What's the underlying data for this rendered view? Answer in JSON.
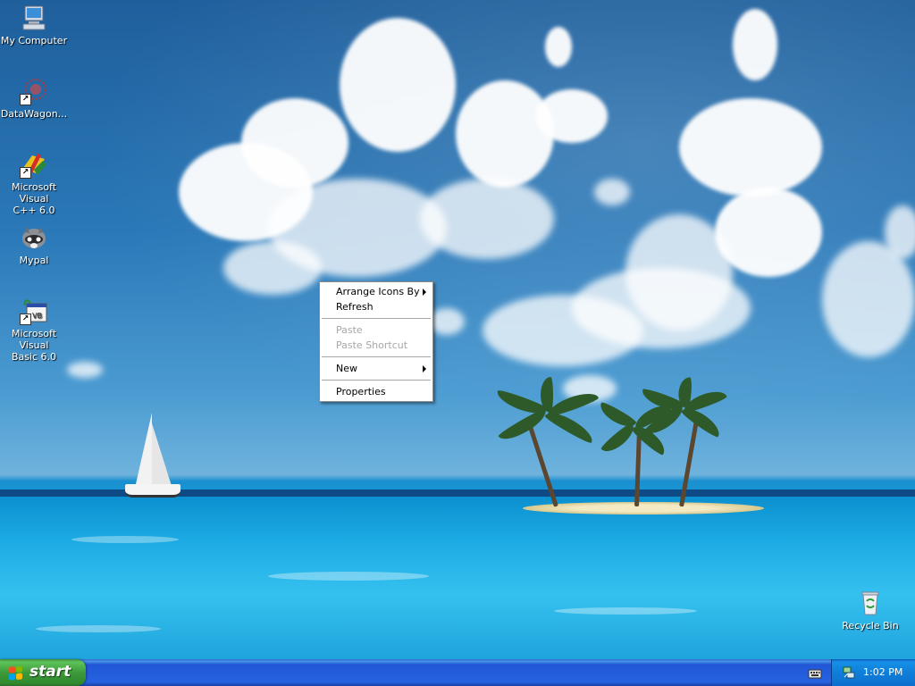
{
  "desktop": {
    "icons": [
      {
        "label_line1": "My Computer",
        "label_line2": "",
        "icon": "my-computer-icon"
      },
      {
        "label_line1": "DataWagon...",
        "label_line2": "",
        "icon": "datawagon-icon"
      },
      {
        "label_line1": "Microsoft Visual",
        "label_line2": "C++ 6.0",
        "icon": "visual-cpp-icon"
      },
      {
        "label_line1": "Mypal",
        "label_line2": "",
        "icon": "mypal-icon"
      },
      {
        "label_line1": "Microsoft Visual",
        "label_line2": "Basic 6.0",
        "icon": "visual-basic-icon"
      },
      {
        "label_line1": "Recycle Bin",
        "label_line2": "",
        "icon": "recycle-bin-icon"
      }
    ]
  },
  "context_menu": {
    "items": [
      {
        "label": "Arrange Icons By",
        "enabled": true,
        "submenu": true
      },
      {
        "label": "Refresh",
        "enabled": true,
        "submenu": false
      },
      {
        "label": "Paste",
        "enabled": false,
        "submenu": false
      },
      {
        "label": "Paste Shortcut",
        "enabled": false,
        "submenu": false
      },
      {
        "label": "New",
        "enabled": true,
        "submenu": true
      },
      {
        "label": "Properties",
        "enabled": true,
        "submenu": false
      }
    ]
  },
  "taskbar": {
    "start_label": "start",
    "clock": "1:02 PM",
    "tray_icons": [
      "keyboard-icon",
      "network-icon"
    ]
  },
  "colors": {
    "taskbar_blue": "#2663e0",
    "start_green": "#3c9a3a",
    "menu_disabled": "#a7a7a7"
  }
}
